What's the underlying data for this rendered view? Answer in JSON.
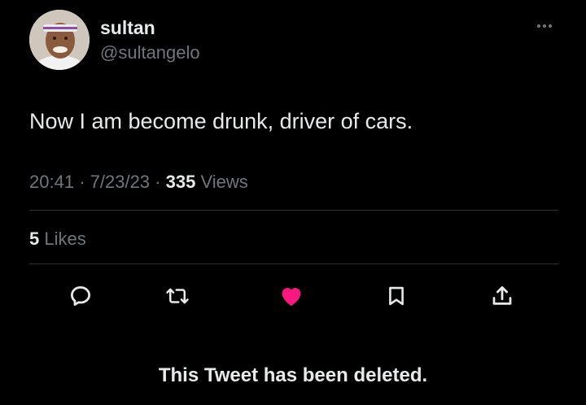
{
  "user": {
    "display_name": "sultan",
    "handle": "@sultangelo"
  },
  "tweet": {
    "text": "Now I am become drunk, driver of cars.",
    "time": "20:41",
    "date": "7/23/23",
    "views_count": "335",
    "views_label": "Views",
    "separator": "·"
  },
  "engagement": {
    "likes_count": "5",
    "likes_label": "Likes"
  },
  "actions": {
    "icons": [
      "reply-icon",
      "retweet-icon",
      "like-icon",
      "bookmark-icon",
      "share-icon"
    ],
    "like_color": "#f91880",
    "icon_color": "#71767b"
  },
  "notice": {
    "text": "This Tweet has been deleted."
  }
}
